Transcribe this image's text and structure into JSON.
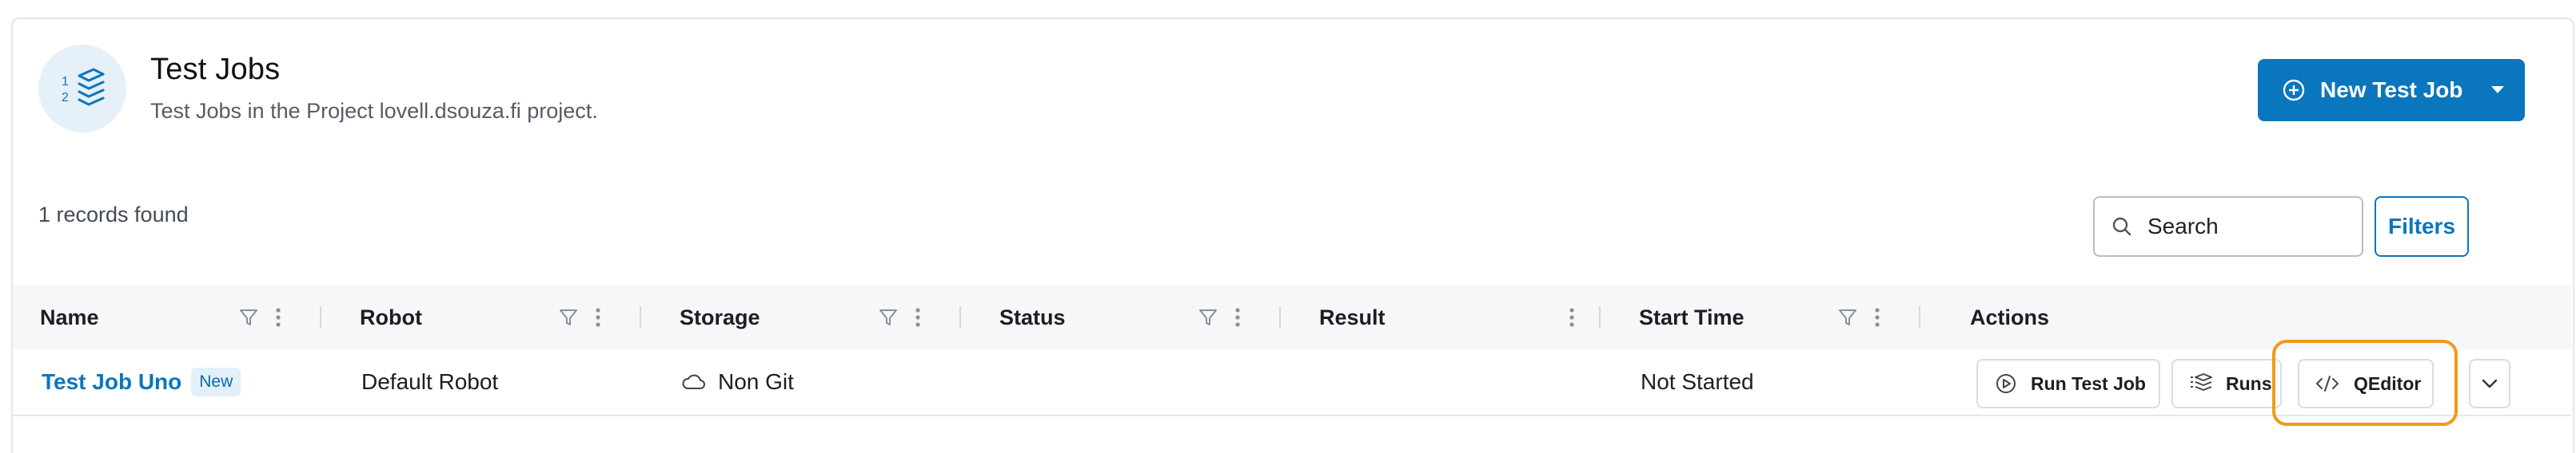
{
  "header": {
    "title": "Test Jobs",
    "subtitle": "Test Jobs in the Project lovell.dsouza.fi project.",
    "icon": "numbered-stack-icon",
    "new_button_label": "New Test Job"
  },
  "toolbar": {
    "records_found": "1 records found",
    "search_placeholder": "Search",
    "filters_label": "Filters"
  },
  "table": {
    "columns": [
      {
        "label": "Name",
        "filter": true,
        "menu": true
      },
      {
        "label": "Robot",
        "filter": true,
        "menu": true
      },
      {
        "label": "Storage",
        "filter": true,
        "menu": true
      },
      {
        "label": "Status",
        "filter": true,
        "menu": true
      },
      {
        "label": "Result",
        "filter": false,
        "menu": true
      },
      {
        "label": "Start Time",
        "filter": true,
        "menu": true
      },
      {
        "label": "Actions",
        "filter": false,
        "menu": false
      }
    ],
    "rows": [
      {
        "name": "Test Job Uno",
        "badge": "New",
        "robot": "Default Robot",
        "storage": "Non Git",
        "storage_icon": "cloud-icon",
        "status": "",
        "result": "",
        "start_time": "Not Started",
        "actions": {
          "run": "Run Test Job",
          "runs": "Runs",
          "qeditor": "QEditor"
        }
      }
    ]
  },
  "colors": {
    "accent": "#0a76bd",
    "highlight": "#f29a1a",
    "header_bg": "#f6f7f8",
    "icon_bg": "#e6f0f8"
  }
}
